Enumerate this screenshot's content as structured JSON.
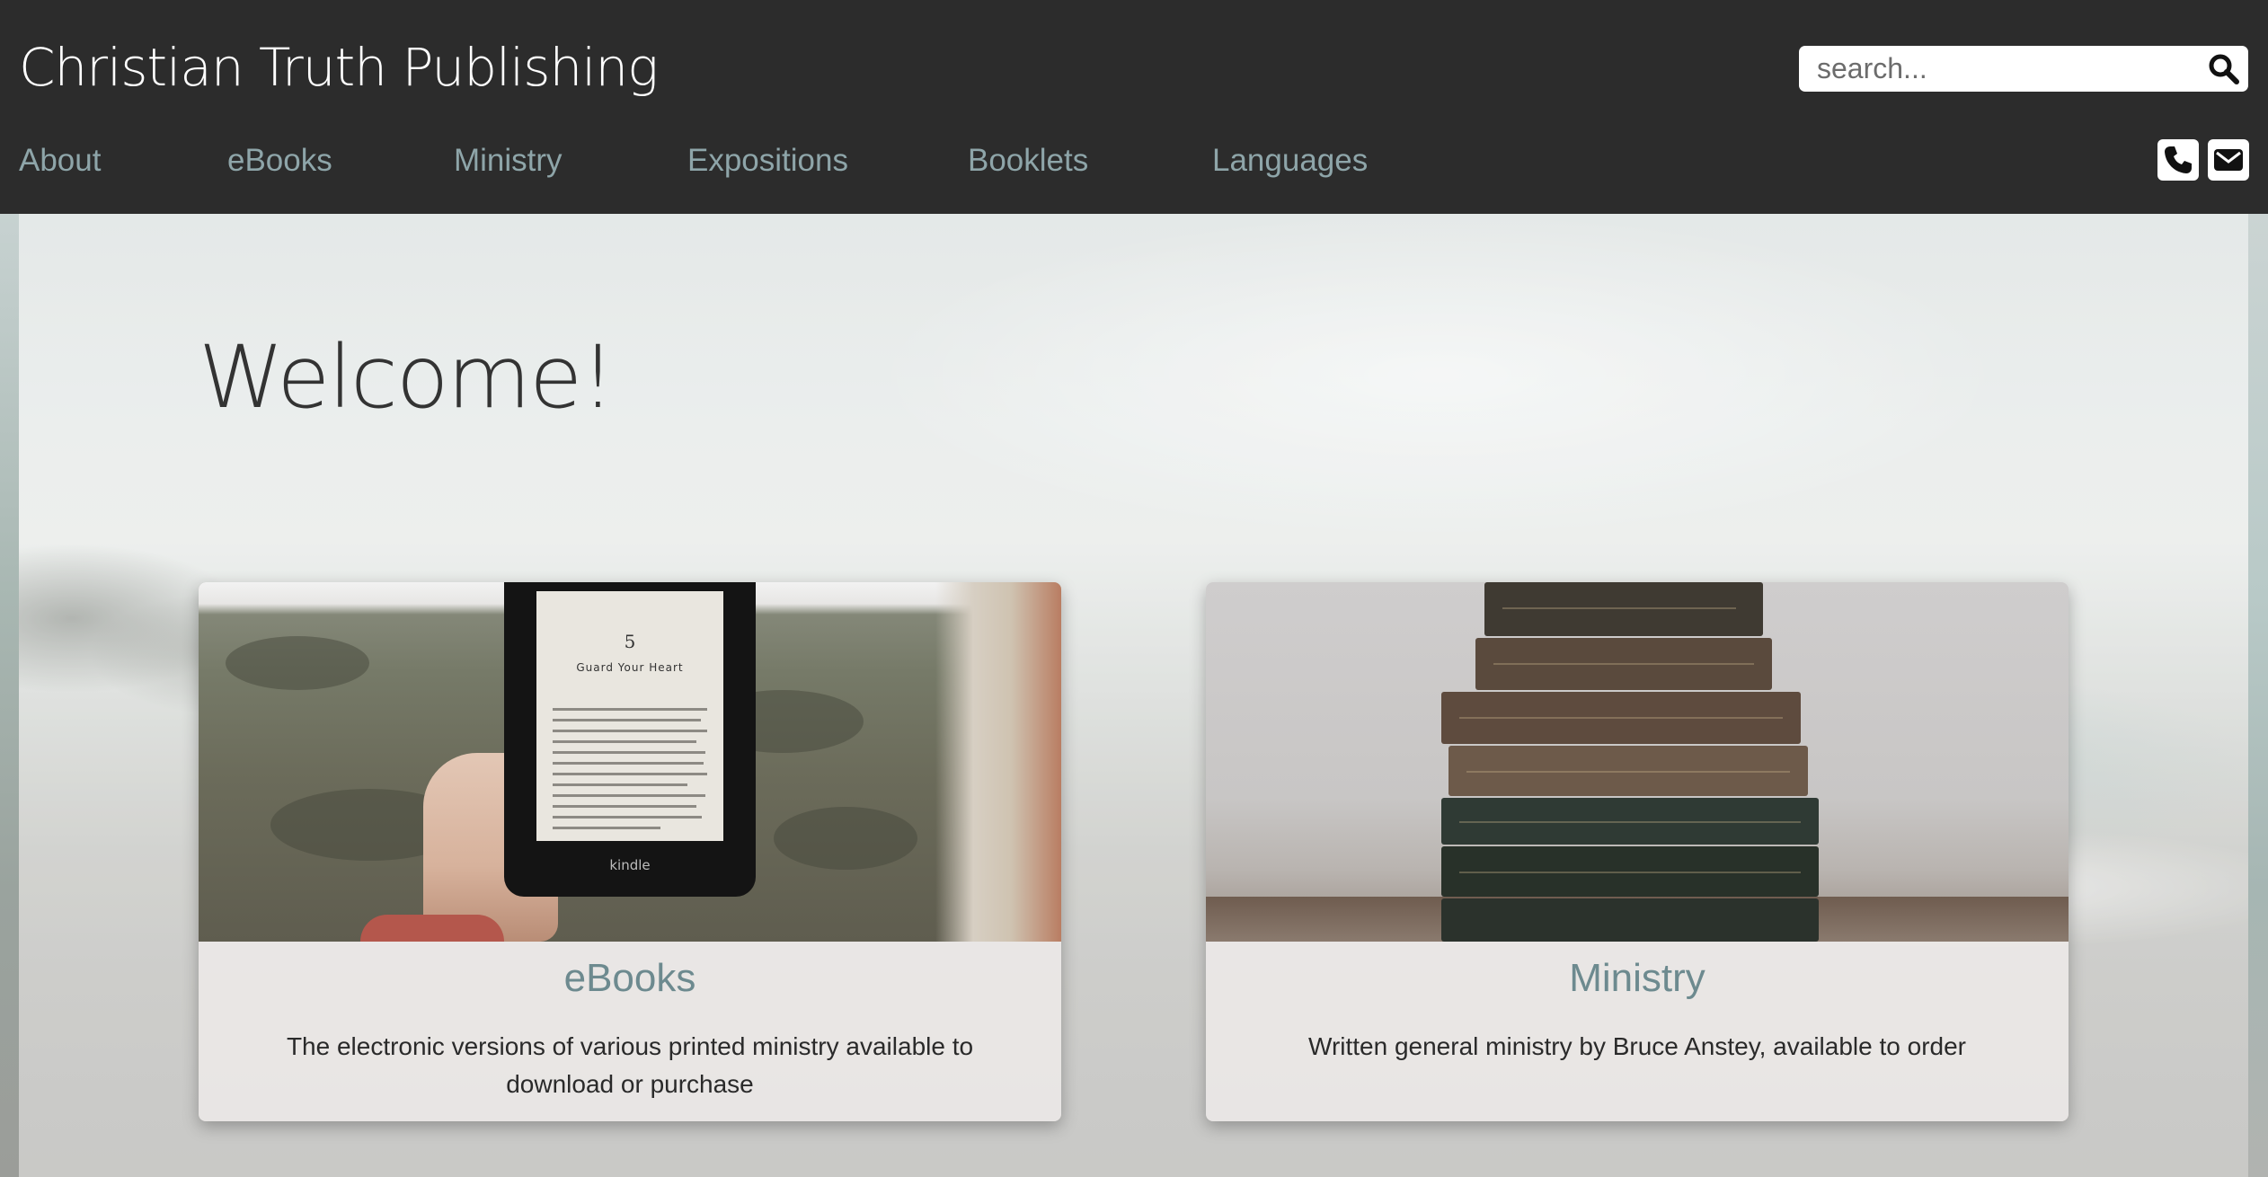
{
  "site": {
    "title": "Christian Truth Publishing"
  },
  "search": {
    "placeholder": "search...",
    "icon": "search-icon"
  },
  "nav": {
    "items": [
      {
        "label": "About"
      },
      {
        "label": "eBooks"
      },
      {
        "label": "Ministry"
      },
      {
        "label": "Expositions"
      },
      {
        "label": "Booklets"
      },
      {
        "label": "Languages"
      }
    ]
  },
  "contact": {
    "phone_icon": "phone-icon",
    "email_icon": "envelope-icon"
  },
  "hero": {
    "heading": "Welcome!"
  },
  "cards": [
    {
      "title": "eBooks",
      "description": "The electronic versions of various printed ministry available to download or purchase",
      "image": {
        "chapter_number": "5",
        "chapter_title": "Guard Your Heart",
        "device_brand": "kindle"
      }
    },
    {
      "title": "Ministry",
      "description": "Written general ministry by Bruce Anstey, available to order"
    }
  ],
  "colors": {
    "header_bg": "#2c2c2c",
    "nav_text": "#8ea5a9",
    "card_title": "#6d8a8f",
    "heading_text": "#333333"
  }
}
